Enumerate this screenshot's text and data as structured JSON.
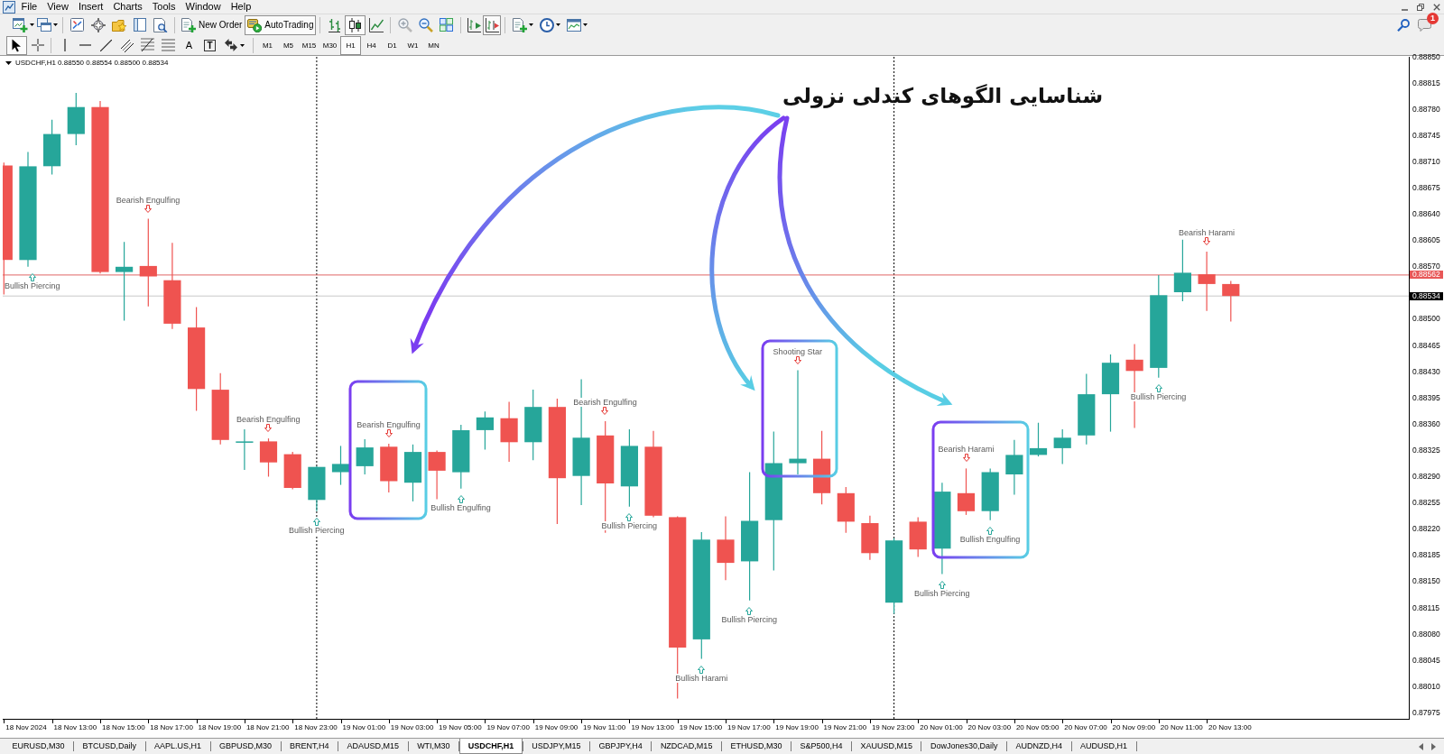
{
  "menu_bar": {
    "items": [
      "File",
      "View",
      "Insert",
      "Charts",
      "Tools",
      "Window",
      "Help"
    ]
  },
  "toolbar": {
    "new_order": {
      "label": "New Order"
    },
    "autotrading": {
      "label": "AutoTrading",
      "on": true
    },
    "chart_types": [
      {
        "kind": "bars",
        "selected": false
      },
      {
        "kind": "candles",
        "selected": true
      },
      {
        "kind": "line",
        "selected": false
      }
    ],
    "chart_shift": {
      "on": false
    },
    "autoscroll": {
      "on": true
    },
    "notifications": {
      "count": "1"
    }
  },
  "drawing_toolbar": {
    "tools": [
      {
        "kind": "cursor",
        "selected": true
      },
      {
        "kind": "crosshair",
        "selected": false
      },
      {
        "kind": "vline",
        "selected": false
      },
      {
        "kind": "hline",
        "selected": false
      },
      {
        "kind": "trendline",
        "selected": false
      },
      {
        "kind": "channel",
        "selected": false
      },
      {
        "kind": "fibo",
        "selected": false
      },
      {
        "kind": "levels",
        "selected": false
      },
      {
        "kind": "text",
        "glyph": "A",
        "selected": false
      },
      {
        "kind": "label",
        "glyph": "T",
        "selected": false
      },
      {
        "kind": "arrows",
        "selected": false
      }
    ],
    "timeframes": [
      {
        "label": "M1",
        "selected": false
      },
      {
        "label": "M5",
        "selected": false
      },
      {
        "label": "M15",
        "selected": false
      },
      {
        "label": "M30",
        "selected": false
      },
      {
        "label": "H1",
        "selected": true
      },
      {
        "label": "H4",
        "selected": false
      },
      {
        "label": "D1",
        "selected": false
      },
      {
        "label": "W1",
        "selected": false
      },
      {
        "label": "MN",
        "selected": false
      }
    ]
  },
  "chart": {
    "header": "USDCHF,H1 0.88550 0.88554 0.88500 0.88534",
    "title_annotation": "شناسایی الگوهای کندلی نزولی",
    "price_axis_labels": [
      "0.88850",
      "0.88815",
      "0.88780",
      "0.88745",
      "0.88710",
      "0.88675",
      "0.88640",
      "0.88605",
      "0.88570",
      "0.88500",
      "0.88465",
      "0.88430",
      "0.88395",
      "0.88360",
      "0.88325",
      "0.88290",
      "0.88255",
      "0.88220",
      "0.88185",
      "0.88150",
      "0.88115",
      "0.88080",
      "0.88045",
      "0.88010",
      "0.87975"
    ],
    "price_tags": [
      {
        "text": "0.88562",
        "kind": "ask"
      },
      {
        "text": "0.88534",
        "kind": "bid"
      }
    ],
    "pattern_labels": [
      {
        "text": "Bullish Piercing",
        "kind": "bullish"
      },
      {
        "text": "Bearish Engulfing",
        "kind": "bearish"
      },
      {
        "text": "Bearish Engulfing",
        "kind": "bearish"
      },
      {
        "text": "Bullish Piercing",
        "kind": "bullish"
      },
      {
        "text": "Bearish Engulfing",
        "kind": "bearish"
      },
      {
        "text": "Bullish Engulfing",
        "kind": "bullish"
      },
      {
        "text": "Bearish Engulfing",
        "kind": "bearish"
      },
      {
        "text": "Bullish Piercing",
        "kind": "bullish"
      },
      {
        "text": "Bullish Harami",
        "kind": "bullish"
      },
      {
        "text": "Bullish Piercing",
        "kind": "bullish"
      },
      {
        "text": "Shooting Star",
        "kind": "bearish"
      },
      {
        "text": "Bullish Piercing",
        "kind": "bullish"
      },
      {
        "text": "Bearish Harami",
        "kind": "bearish"
      },
      {
        "text": "Bullish Engulfing",
        "kind": "bullish"
      },
      {
        "text": "Bullish Piercing",
        "kind": "bullish"
      },
      {
        "text": "Bearish Harami",
        "kind": "bearish"
      }
    ],
    "time_axis_labels": [
      "18 Nov 2024",
      "18 Nov 13:00",
      "18 Nov 15:00",
      "18 Nov 17:00",
      "18 Nov 19:00",
      "18 Nov 21:00",
      "18 Nov 23:00",
      "19 Nov 01:00",
      "19 Nov 03:00",
      "19 Nov 05:00",
      "19 Nov 07:00",
      "19 Nov 09:00",
      "19 Nov 11:00",
      "19 Nov 13:00",
      "19 Nov 15:00",
      "19 Nov 17:00",
      "19 Nov 19:00",
      "19 Nov 21:00",
      "19 Nov 23:00",
      "20 Nov 01:00",
      "20 Nov 03:00",
      "20 Nov 05:00",
      "20 Nov 07:00",
      "20 Nov 09:00",
      "20 Nov 11:00",
      "20 Nov 13:00"
    ]
  },
  "tabs": [
    {
      "label": "EURUSD,M30",
      "selected": false
    },
    {
      "label": "BTCUSD,Daily",
      "selected": false
    },
    {
      "label": "AAPL.US,H1",
      "selected": false
    },
    {
      "label": "GBPUSD,M30",
      "selected": false
    },
    {
      "label": "BRENT,H4",
      "selected": false
    },
    {
      "label": "ADAUSD,M15",
      "selected": false
    },
    {
      "label": "WTI,M30",
      "selected": false
    },
    {
      "label": "USDCHF,H1",
      "selected": true
    },
    {
      "label": "USDJPY,M15",
      "selected": false
    },
    {
      "label": "GBPJPY,H4",
      "selected": false
    },
    {
      "label": "NZDCAD,M15",
      "selected": false
    },
    {
      "label": "ETHUSD,M30",
      "selected": false
    },
    {
      "label": "S&P500,H4",
      "selected": false
    },
    {
      "label": "XAUUSD,M15",
      "selected": false
    },
    {
      "label": "DowJones30,Daily",
      "selected": false
    },
    {
      "label": "AUDNZD,H4",
      "selected": false
    },
    {
      "label": "AUDUSD,H1",
      "selected": false
    }
  ]
}
